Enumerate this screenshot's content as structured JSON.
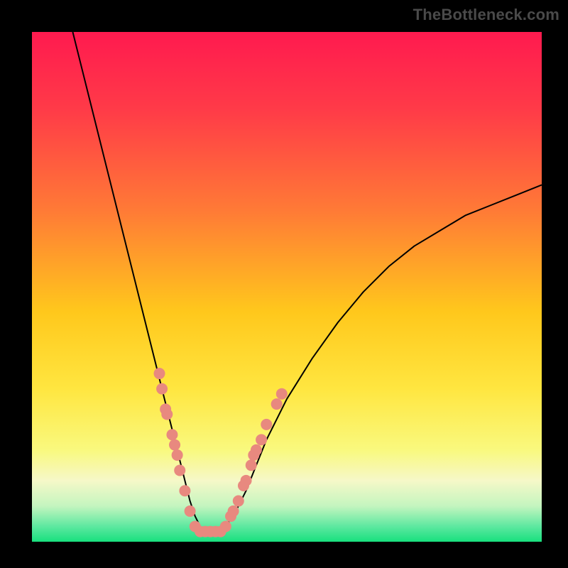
{
  "watermark": "TheBottleneck.com",
  "chart_data": {
    "type": "line",
    "title": "",
    "xlabel": "",
    "ylabel": "",
    "xlim": [
      0,
      100
    ],
    "ylim": [
      0,
      100
    ],
    "grid": false,
    "gradient_stops": [
      {
        "offset": 0.0,
        "color": "#ff1a4f"
      },
      {
        "offset": 0.15,
        "color": "#ff3a48"
      },
      {
        "offset": 0.35,
        "color": "#ff7a36"
      },
      {
        "offset": 0.55,
        "color": "#ffc81c"
      },
      {
        "offset": 0.7,
        "color": "#ffe640"
      },
      {
        "offset": 0.82,
        "color": "#f9f97e"
      },
      {
        "offset": 0.88,
        "color": "#f6f8c8"
      },
      {
        "offset": 0.93,
        "color": "#c4f5bf"
      },
      {
        "offset": 0.97,
        "color": "#5de8a0"
      },
      {
        "offset": 1.0,
        "color": "#18e07e"
      }
    ],
    "series": [
      {
        "name": "bottleneck-curve",
        "color": "#000000",
        "width": 2,
        "x": [
          8,
          10,
          12,
          14,
          16,
          18,
          20,
          22,
          24,
          26,
          28,
          29,
          30,
          31,
          32,
          33,
          34,
          35,
          36,
          38,
          40,
          42,
          44,
          46,
          50,
          55,
          60,
          65,
          70,
          75,
          80,
          85,
          90,
          95,
          100
        ],
        "y": [
          100,
          92,
          84,
          76,
          68,
          60,
          52,
          44,
          36,
          28,
          20,
          16,
          12,
          8,
          5,
          3,
          2,
          2,
          2,
          3,
          6,
          10,
          15,
          20,
          28,
          36,
          43,
          49,
          54,
          58,
          61,
          64,
          66,
          68,
          70
        ]
      }
    ],
    "marker_series": [
      {
        "name": "markers-left",
        "color": "#e8897f",
        "radius": 8,
        "points": [
          {
            "x": 25.0,
            "y": 33
          },
          {
            "x": 25.5,
            "y": 30
          },
          {
            "x": 26.2,
            "y": 26
          },
          {
            "x": 26.5,
            "y": 25
          },
          {
            "x": 27.5,
            "y": 21
          },
          {
            "x": 28.0,
            "y": 19
          },
          {
            "x": 28.5,
            "y": 17
          },
          {
            "x": 29.0,
            "y": 14
          },
          {
            "x": 30.0,
            "y": 10
          },
          {
            "x": 31.0,
            "y": 6
          }
        ]
      },
      {
        "name": "markers-bottom",
        "color": "#e8897f",
        "radius": 8,
        "points": [
          {
            "x": 32.0,
            "y": 3
          },
          {
            "x": 33.0,
            "y": 2
          },
          {
            "x": 34.0,
            "y": 2
          },
          {
            "x": 35.0,
            "y": 2
          },
          {
            "x": 36.0,
            "y": 2
          },
          {
            "x": 37.0,
            "y": 2
          }
        ]
      },
      {
        "name": "markers-right",
        "color": "#e8897f",
        "radius": 8,
        "points": [
          {
            "x": 38.0,
            "y": 3
          },
          {
            "x": 39.0,
            "y": 5
          },
          {
            "x": 39.5,
            "y": 6
          },
          {
            "x": 40.5,
            "y": 8
          },
          {
            "x": 41.5,
            "y": 11
          },
          {
            "x": 42.0,
            "y": 12
          },
          {
            "x": 43.0,
            "y": 15
          },
          {
            "x": 43.5,
            "y": 17
          },
          {
            "x": 44.0,
            "y": 18
          },
          {
            "x": 45.0,
            "y": 20
          },
          {
            "x": 46.0,
            "y": 23
          },
          {
            "x": 48.0,
            "y": 27
          },
          {
            "x": 49.0,
            "y": 29
          }
        ]
      }
    ]
  }
}
